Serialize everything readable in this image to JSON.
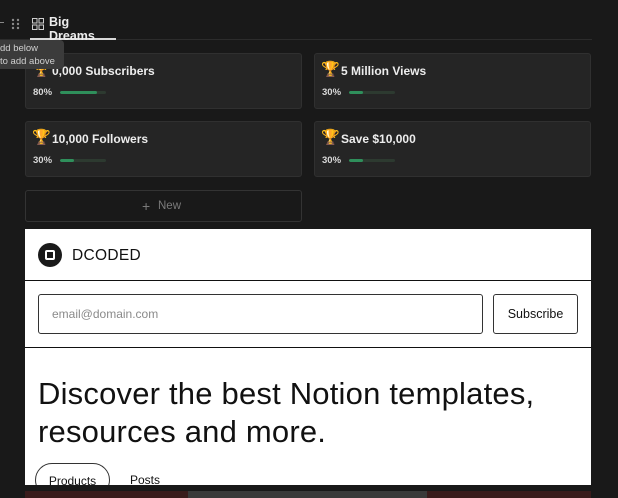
{
  "toolbar": {
    "view_tab_label": "Big Dreams",
    "tooltip_line1": "dd below",
    "tooltip_line2": "to add above"
  },
  "cards": [
    {
      "icon": "🏆",
      "title": "0,000 Subscribers",
      "progress_label": "80%",
      "progress": 0.8
    },
    {
      "icon": "🏆",
      "title": "5 Million Views",
      "progress_label": "30%",
      "progress": 0.3
    },
    {
      "icon": "🏆",
      "title": "10,000 Followers",
      "progress_label": "30%",
      "progress": 0.3
    },
    {
      "icon": "🏆",
      "title": "Save $10,000",
      "progress_label": "30%",
      "progress": 0.3
    }
  ],
  "new_button": {
    "icon": "+",
    "label": "New"
  },
  "embed": {
    "brand": "DCODED",
    "email_placeholder": "email@domain.com",
    "subscribe_label": "Subscribe",
    "headline": "Discover the best Notion templates, resources and more.",
    "tabs": [
      {
        "label": "Products",
        "active": true
      },
      {
        "label": "Posts",
        "active": false
      }
    ]
  },
  "colors": {
    "background": "#191919",
    "card": "#252525",
    "progress_fill": "#2f8f5b",
    "embed_bg": "#ffffff"
  }
}
